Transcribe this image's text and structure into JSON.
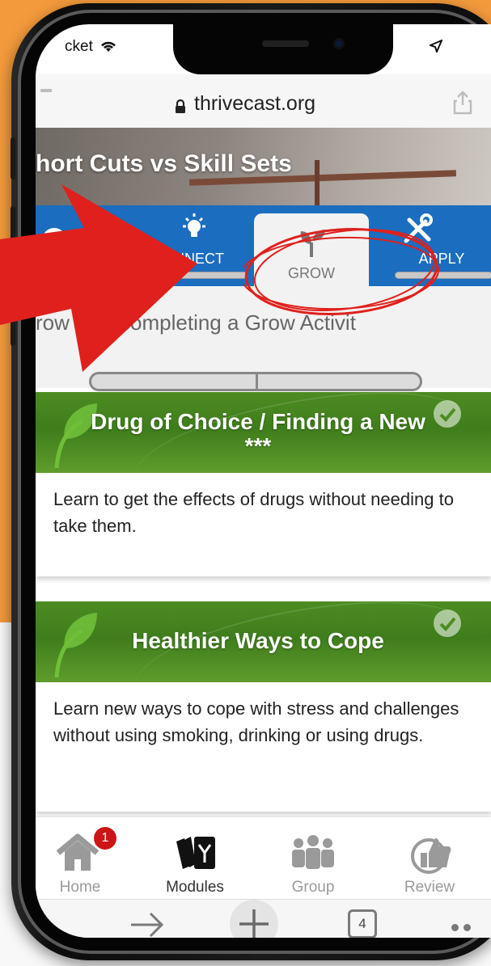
{
  "status_bar": {
    "carrier": "cket"
  },
  "browser": {
    "url": "thrivecast.org",
    "tabs_count": "4"
  },
  "module": {
    "title": "hort Cuts vs Skill Sets",
    "tabs": [
      {
        "label": "ONNECT",
        "icon": "lightbulb-icon",
        "selected": false
      },
      {
        "label": "GROW",
        "icon": "sprout-icon",
        "selected": true
      },
      {
        "label": "APPLY",
        "icon": "tools-icon",
        "selected": false
      }
    ],
    "progress_text": "row        s by completing a Grow Activit",
    "progress_fraction": 0
  },
  "cards": [
    {
      "title": "Drug of Choice / Finding a New ***",
      "description": "Learn to get the effects of drugs without needing to take them."
    },
    {
      "title": "Healthier Ways to Cope",
      "description": "Learn new ways to cope with stress and challenges without using smoking, drinking or using drugs."
    }
  ],
  "bottom_nav": {
    "items": [
      {
        "label": "Home",
        "icon": "home-icon",
        "badge": "1"
      },
      {
        "label": "Modules",
        "icon": "modules-icon",
        "active": true
      },
      {
        "label": "Group",
        "icon": "group-icon"
      },
      {
        "label": "Review",
        "icon": "thumbs-up-icon"
      }
    ]
  },
  "colors": {
    "background": "#f39a3c",
    "tabs_blue": "#1a6dbf",
    "card_green": "#3f7d1c",
    "annotation_red": "#e0201c",
    "badge_red": "#cc1515"
  }
}
